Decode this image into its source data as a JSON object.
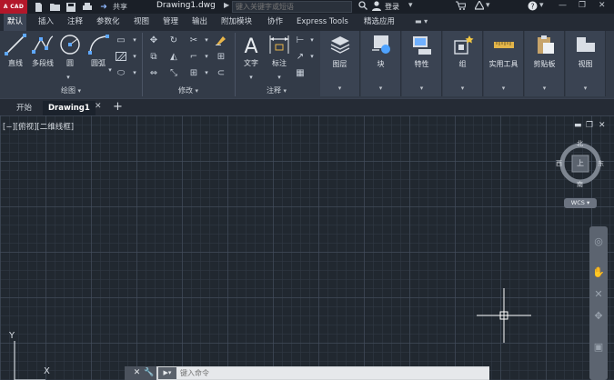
{
  "titlebar": {
    "logo_text": "A CAD",
    "share": "共享",
    "doc_title": "Drawing1.dwg",
    "search_placeholder": "键入关键字或短语",
    "login": "登录"
  },
  "ribbon_tabs": [
    "默认",
    "插入",
    "注释",
    "参数化",
    "视图",
    "管理",
    "输出",
    "附加模块",
    "协作",
    "Express Tools",
    "精选应用"
  ],
  "active_tab": "默认",
  "panels": {
    "draw": {
      "title": "绘图",
      "tools": [
        "直线",
        "多段线",
        "圆",
        "圆弧"
      ]
    },
    "modify": {
      "title": "修改"
    },
    "annotation": {
      "title": "注释",
      "tools": [
        "文字",
        "标注"
      ]
    },
    "right_tools": [
      "图层",
      "块",
      "特性",
      "组",
      "实用工具",
      "剪贴板",
      "视图"
    ]
  },
  "doc_tabs": [
    "开始",
    "Drawing1"
  ],
  "active_doc": "Drawing1",
  "viewport_label": "[−][俯视][二维线框]",
  "viewcube": {
    "north": "北",
    "south": "南",
    "east": "东",
    "west": "西",
    "face": "上",
    "wcs": "WCS"
  },
  "ucs": {
    "x": "X",
    "y": "Y"
  },
  "command_line": {
    "placeholder": "键入命令"
  },
  "colors": {
    "app_red": "#b3172a",
    "ribbon_bg": "#333b48",
    "canvas_bg": "#212830"
  }
}
